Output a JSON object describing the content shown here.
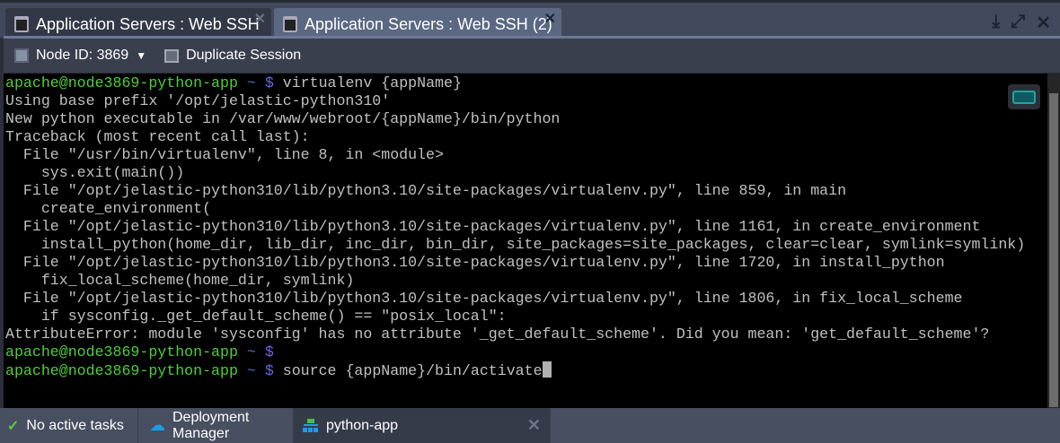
{
  "tabs": [
    {
      "label": "Application Servers : Web SSH",
      "active": false
    },
    {
      "label": "Application Servers : Web SSH (2)",
      "active": true
    }
  ],
  "toolbar": {
    "node_label": "Node ID: 3869",
    "duplicate_label": "Duplicate Session"
  },
  "terminal": {
    "prompt_user": "apache@node3869-python-app",
    "prompt_tilde": "~",
    "prompt_dollar": "$",
    "cmd1": "virtualenv {appName}",
    "output": [
      "Using base prefix '/opt/jelastic-python310'",
      "New python executable in /var/www/webroot/{appName}/bin/python",
      "Traceback (most recent call last):",
      "  File \"/usr/bin/virtualenv\", line 8, in <module>",
      "    sys.exit(main())",
      "  File \"/opt/jelastic-python310/lib/python3.10/site-packages/virtualenv.py\", line 859, in main",
      "    create_environment(",
      "  File \"/opt/jelastic-python310/lib/python3.10/site-packages/virtualenv.py\", line 1161, in create_environment",
      "    install_python(home_dir, lib_dir, inc_dir, bin_dir, site_packages=site_packages, clear=clear, symlink=symlink)",
      "  File \"/opt/jelastic-python310/lib/python3.10/site-packages/virtualenv.py\", line 1720, in install_python",
      "    fix_local_scheme(home_dir, symlink)",
      "  File \"/opt/jelastic-python310/lib/python3.10/site-packages/virtualenv.py\", line 1806, in fix_local_scheme",
      "    if sysconfig._get_default_scheme() == \"posix_local\":",
      "AttributeError: module 'sysconfig' has no attribute '_get_default_scheme'. Did you mean: 'get_default_scheme'?"
    ],
    "cmd3": "source {appName}/bin/activate"
  },
  "bottom": {
    "tasks": "No active tasks",
    "deployment": "Deployment Manager",
    "env": "python-app"
  }
}
